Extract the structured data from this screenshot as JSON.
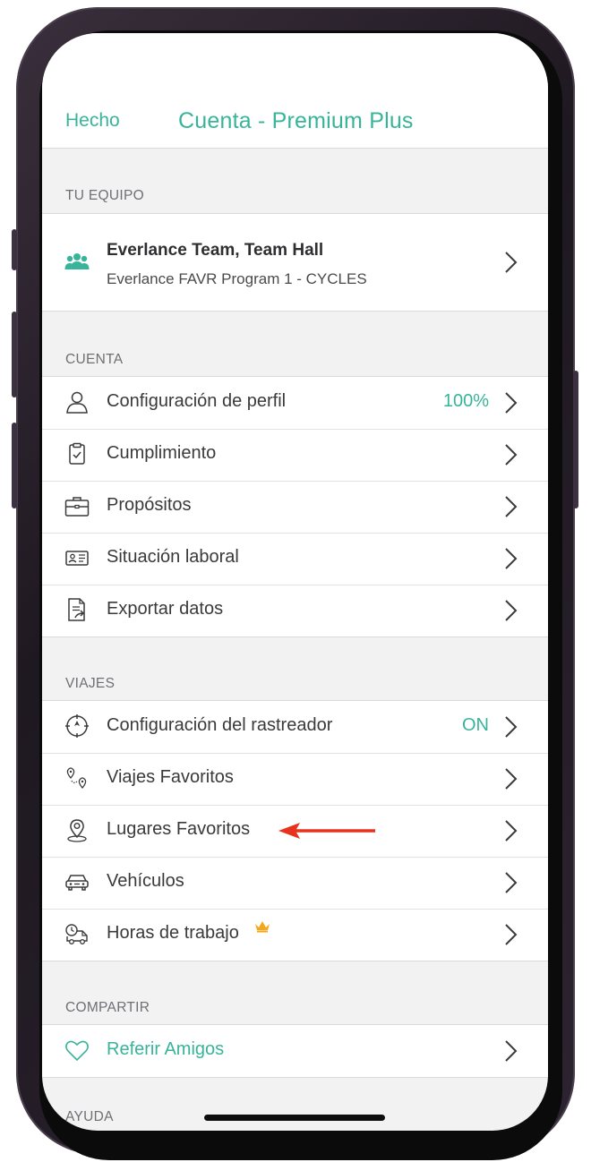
{
  "nav": {
    "done_label": "Hecho",
    "title": "Cuenta - Premium Plus"
  },
  "sections": {
    "team": {
      "header": "TU EQUIPO",
      "team_name": "Everlance Team, Team Hall",
      "program": "Everlance FAVR Program 1 - CYCLES"
    },
    "account": {
      "header": "CUENTA",
      "items": [
        {
          "label": "Configuración de perfil",
          "value": "100%",
          "icon": "person-icon"
        },
        {
          "label": "Cumplimiento",
          "icon": "clipboard-check-icon"
        },
        {
          "label": "Propósitos",
          "icon": "briefcase-icon"
        },
        {
          "label": "Situación laboral",
          "icon": "id-card-icon"
        },
        {
          "label": "Exportar datos",
          "icon": "export-document-icon"
        }
      ]
    },
    "trips": {
      "header": "VIAJES",
      "items": [
        {
          "label": "Configuración del rastreador",
          "value": "ON",
          "icon": "tracker-crosshair-icon"
        },
        {
          "label": "Viajes Favoritos",
          "icon": "route-pins-icon"
        },
        {
          "label": "Lugares Favoritos",
          "icon": "location-pin-icon"
        },
        {
          "label": "Vehículos",
          "icon": "car-icon"
        },
        {
          "label": "Horas de trabajo",
          "icon": "truck-clock-icon",
          "badge": "crown-icon"
        }
      ]
    },
    "share": {
      "header": "COMPARTIR",
      "items": [
        {
          "label": "Referir Amigos",
          "icon": "heart-icon"
        }
      ]
    },
    "help": {
      "header": "AYUDA"
    }
  },
  "colors": {
    "accent": "#38b49a",
    "annotation_arrow": "#e8321e",
    "crown": "#f2a81d",
    "background": "#f2f2f3"
  }
}
